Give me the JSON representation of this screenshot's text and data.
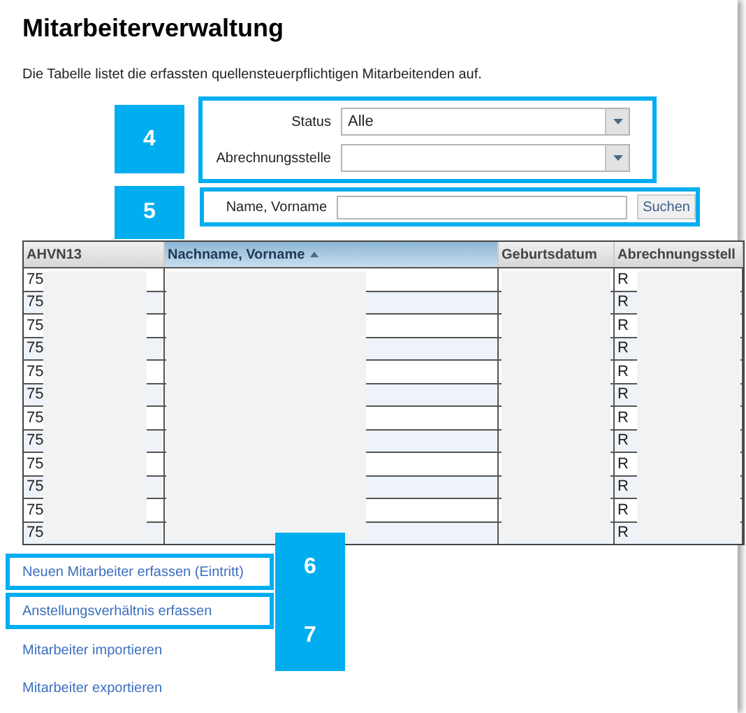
{
  "title": "Mitarbeiterverwaltung",
  "description": "Die Tabelle listet die erfassten quellensteuerpflichtigen Mitarbeitenden auf.",
  "filters": [
    {
      "label": "Status",
      "value": "Alle"
    },
    {
      "label": "Abrechnungsstelle"
    }
  ],
  "search": {
    "label": "Name, Vorname",
    "button": "Suchen"
  },
  "table": {
    "columns": [
      {
        "label": "AHVN13",
        "sorted": false
      },
      {
        "label": "Nachname, Vorname",
        "sorted": true
      },
      {
        "label": "Geburtsdatum",
        "sorted": false
      },
      {
        "label": "Abrechnungsstell",
        "sorted": false
      }
    ],
    "rows": [
      [
        "75",
        "",
        "",
        "R"
      ],
      [
        "75",
        "",
        "",
        "R"
      ],
      [
        "75",
        "",
        "",
        "R"
      ],
      [
        "75",
        "",
        "",
        "R"
      ],
      [
        "75",
        "",
        "",
        "R"
      ],
      [
        "75",
        "",
        "",
        "R"
      ],
      [
        "75",
        "",
        "",
        "R"
      ],
      [
        "75",
        "",
        "",
        "R"
      ],
      [
        "75",
        "",
        "",
        "R"
      ],
      [
        "75",
        "",
        "",
        "R"
      ],
      [
        "75",
        "",
        "",
        "R"
      ],
      [
        "75",
        "",
        "",
        "R"
      ]
    ]
  },
  "links": [
    {
      "label": "Neuen Mitarbeiter erfassen (Eintritt)",
      "highlighted": true
    },
    {
      "label": "Anstellungsverhältnis erfassen",
      "highlighted": true
    },
    {
      "label": "Mitarbeiter importieren",
      "highlighted": false
    },
    {
      "label": "Mitarbeiter exportieren",
      "highlighted": false
    }
  ],
  "callouts": [
    {
      "label": "4"
    },
    {
      "label": "5"
    },
    {
      "label": "6"
    },
    {
      "label": "7"
    }
  ]
}
